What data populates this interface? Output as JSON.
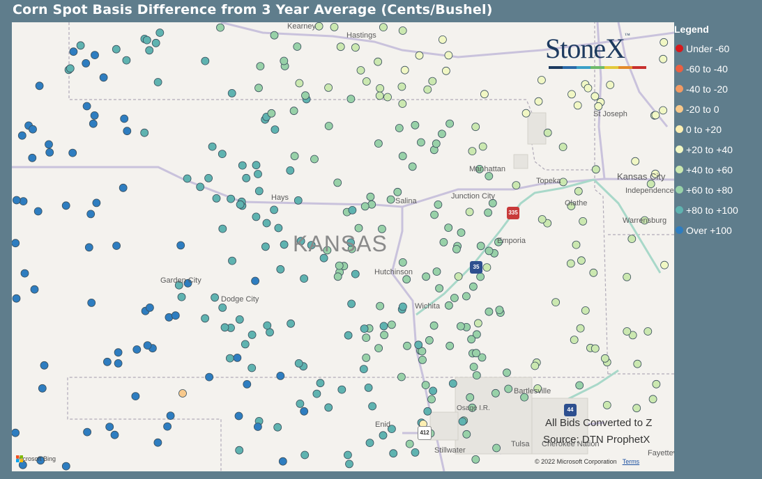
{
  "title": "Corn Spot Basis Difference from 3 Year Average (Cents/Bushel)",
  "legend": {
    "title": "Legend",
    "items": [
      {
        "label": "Under -60",
        "color": "#d7191c"
      },
      {
        "label": "-60 to -40",
        "color": "#ea6042"
      },
      {
        "label": "-40 to -20",
        "color": "#f29a64"
      },
      {
        "label": "-20 to 0",
        "color": "#f8c98c"
      },
      {
        "label": "0 to +20",
        "color": "#fdefb3"
      },
      {
        "label": "+20 to +40",
        "color": "#f1f7c4"
      },
      {
        "label": "+40 to +60",
        "color": "#cbe8b0"
      },
      {
        "label": "+60 to +80",
        "color": "#98d1a8"
      },
      {
        "label": "+80 to +100",
        "color": "#5fb3b0"
      },
      {
        "label": "Over +100",
        "color": "#2e7dc0"
      }
    ]
  },
  "map": {
    "state_label": "KANSAS",
    "places": [
      "Kearney",
      "Hastings",
      "St Joseph",
      "Manhattan",
      "Kansas City",
      "Independence",
      "Topeka",
      "Junction City",
      "Olathe",
      "Salina",
      "Hays",
      "Warrensburg",
      "Emporia",
      "Hutchinson",
      "Garden City",
      "Dodge City",
      "Wichita",
      "Bartlesville",
      "Osage I.R.",
      "Enid",
      "Tulsa",
      "Cherokee Nation",
      "Stillwater",
      "Fayetteville"
    ],
    "highway_shields": [
      "335",
      "35",
      "44",
      "412"
    ]
  },
  "logo": {
    "text": "StoneX",
    "tm": "™",
    "stripe_colors": [
      "#1d3a5f",
      "#2a6aa8",
      "#3aa0c8",
      "#6fba6a",
      "#e2c93b",
      "#e48a2a",
      "#c8302e"
    ]
  },
  "notes": {
    "line1": "All Bids Converted to Z",
    "line2": "Source: DTN ProphetX"
  },
  "attribution": {
    "bing": "Microsoft Bing",
    "copyright": "© 2022 Microsoft Corporation",
    "terms": "Terms"
  }
}
